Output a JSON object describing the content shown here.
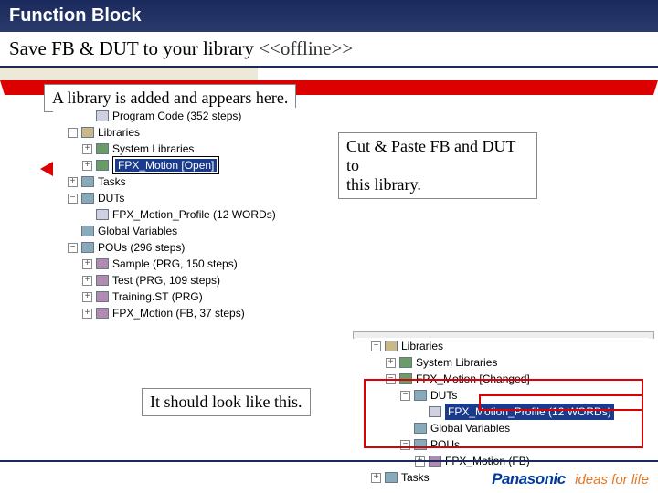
{
  "title": "Function Block",
  "subtitle_a": "Save FB & DUT to your library  ",
  "subtitle_b": "<<offline>>",
  "annot1": "A library is added and appears here.",
  "annot2a": "Cut & Paste FB and DUT to",
  "annot2b": "this library.",
  "annot3": "It should look like this.",
  "tree1": {
    "progcode": "Program Code (352 steps)",
    "libraries": "Libraries",
    "syslib": "System Libraries",
    "fpxopen": "FPX_Motion [Open]",
    "tasks": "Tasks",
    "duts": "DUTs",
    "dut1": "FPX_Motion_Profile (12 WORDs)",
    "globals": "Global Variables",
    "pous": "POUs (296 steps)",
    "p1": "Sample (PRG, 150 steps)",
    "p2": "Test (PRG, 109 steps)",
    "p3": "Training.ST (PRG)",
    "p4": "FPX_Motion (FB, 37 steps)"
  },
  "tree2": {
    "libraries": "Libraries",
    "syslib": "System Libraries",
    "fpxchg": "FPX_Motion [Changed]",
    "duts": "DUTs",
    "dut1": "FPX_Motion_Profile (12 WORDs)",
    "globals": "Global Variables",
    "pous": "POUs",
    "p1": "FPX_Motion (FB)",
    "tasks": "Tasks"
  },
  "logo": {
    "brand": "Panasonic",
    "tag": "ideas for life"
  }
}
